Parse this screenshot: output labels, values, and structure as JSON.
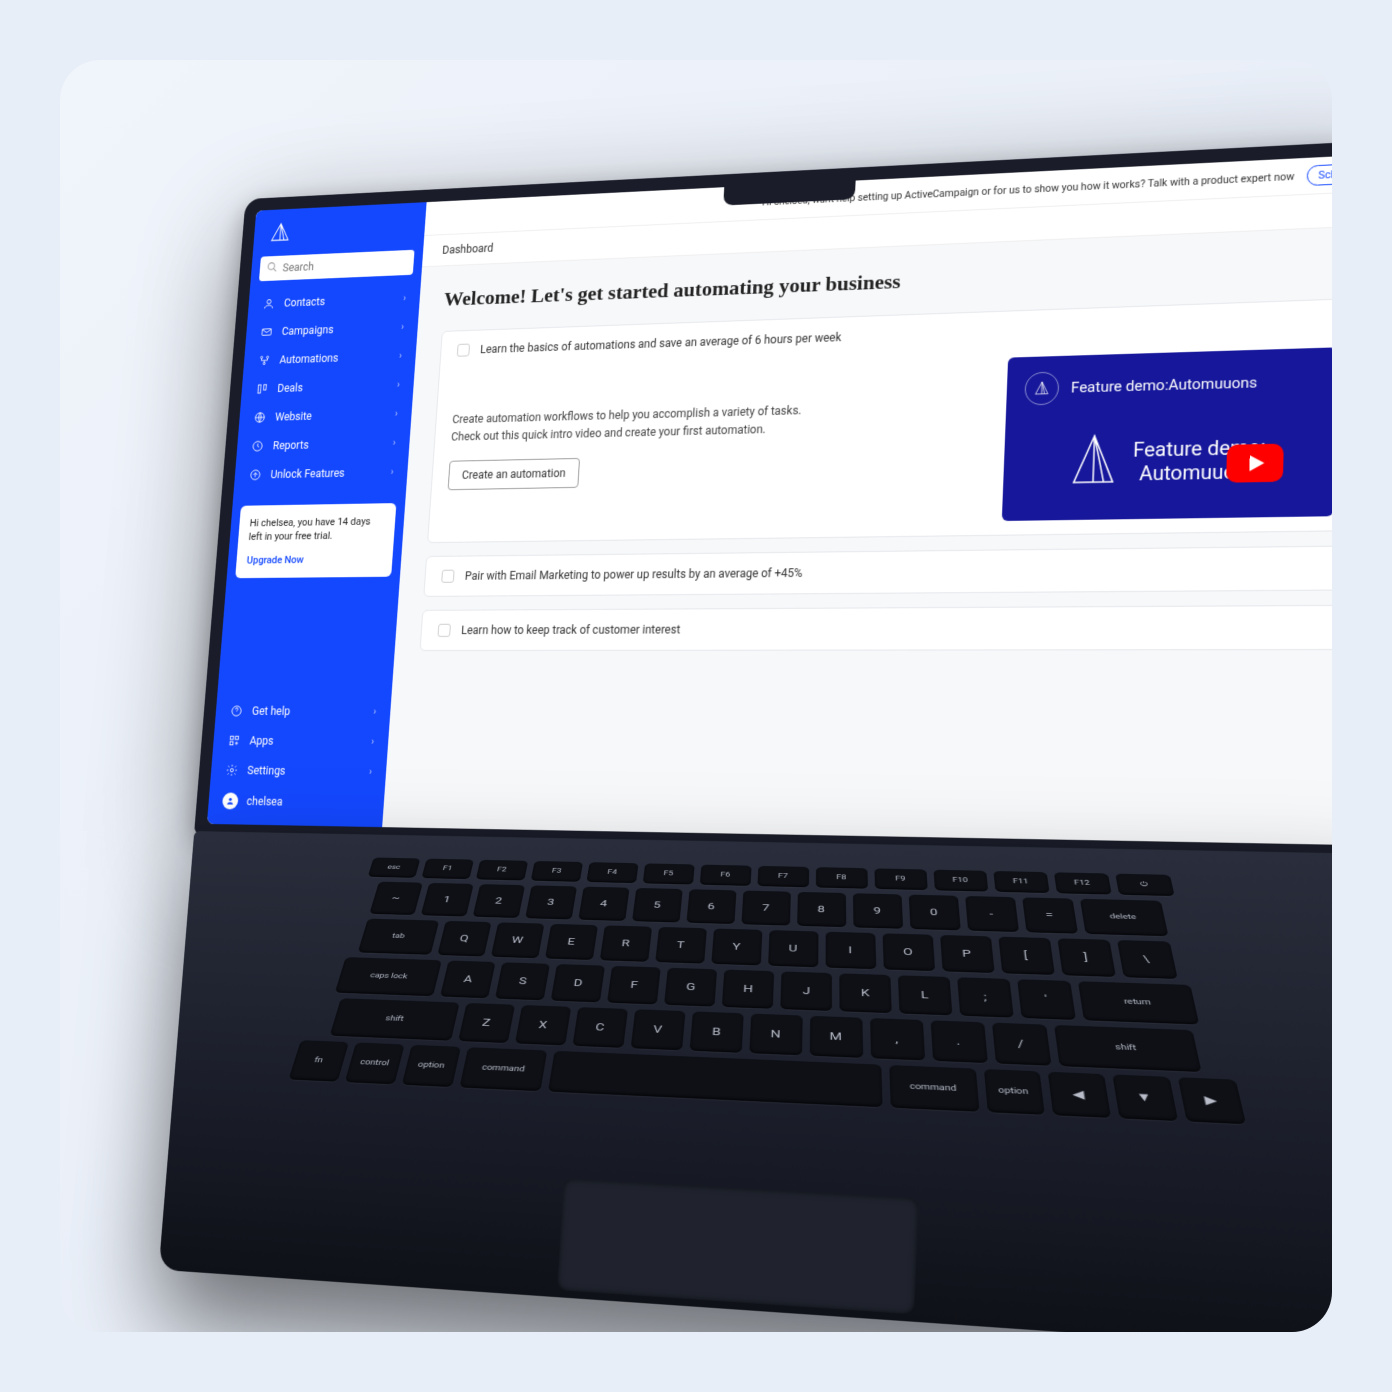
{
  "search": {
    "placeholder": "Search"
  },
  "sidebar": {
    "items": [
      {
        "label": "Contacts"
      },
      {
        "label": "Campaigns"
      },
      {
        "label": "Automations"
      },
      {
        "label": "Deals"
      },
      {
        "label": "Website"
      },
      {
        "label": "Reports"
      },
      {
        "label": "Unlock Features"
      }
    ],
    "bottom": [
      {
        "label": "Get help"
      },
      {
        "label": "Apps"
      },
      {
        "label": "Settings"
      }
    ],
    "user": "chelsea"
  },
  "trial": {
    "message": "Hi chelsea, you have 14 days left in your free trial.",
    "cta": "Upgrade Now"
  },
  "banner": {
    "text": "Hi chelsea, want help setting up ActiveCampaign or for us to show you how it works? Talk with a product expert now",
    "button": "Schedule"
  },
  "breadcrumb": "Dashboard",
  "welcome": "Welcome!  Let's get started automating your business",
  "tasks": {
    "t1": "Learn the basics of automations and save an average of 6 hours per week",
    "t1_body_l1": "Create automation workflows to help you accomplish a variety of tasks.",
    "t1_body_l2": "Check out this quick intro video and create your first automation.",
    "t1_cta": "Create an automation",
    "t2": "Pair with Email Marketing to power up results by an average of +45%",
    "t3": "Learn how to keep track of customer interest"
  },
  "video": {
    "header": "Feature demo:Automuuons",
    "title_l1": "Feature demo:",
    "title_l2": "Automuuons"
  }
}
